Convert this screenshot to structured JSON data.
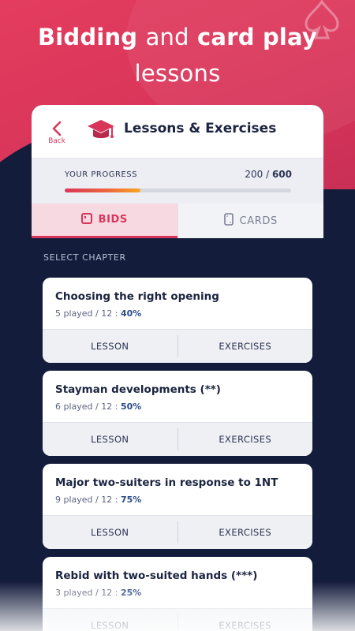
{
  "headline": {
    "line1_bold": "Bidding",
    "line1_light": "and",
    "line1_bold2": "card play",
    "line2": "lessons"
  },
  "header": {
    "back_label": "Back",
    "title": "Lessons & Exercises"
  },
  "progress": {
    "label": "YOUR PROGRESS",
    "current": "200",
    "separator": " / ",
    "total": "600",
    "fraction": 0.333
  },
  "tabs": [
    {
      "label": "BIDS",
      "active": true,
      "icon": "bids-icon"
    },
    {
      "label": "CARDS",
      "active": false,
      "icon": "card-icon"
    }
  ],
  "section_label": "SELECT CHAPTER",
  "chapters": [
    {
      "title": "Choosing the right opening",
      "stats": "5 played / 12 : ",
      "pct": "40%",
      "lesson": "LESSON",
      "exercises": "EXERCISES"
    },
    {
      "title": "Stayman developments (**)",
      "stats": "6 played / 12 : ",
      "pct": "50%",
      "lesson": "LESSON",
      "exercises": "EXERCISES"
    },
    {
      "title": "Major two-suiters in response to 1NT",
      "stats": "9 played / 12 : ",
      "pct": "75%",
      "lesson": "LESSON",
      "exercises": "EXERCISES"
    },
    {
      "title": "Rebid with two-suited hands (***)",
      "stats": "3 played / 12 : ",
      "pct": "25%",
      "lesson": "LESSON",
      "exercises": "EXERCISES"
    }
  ],
  "colors": {
    "accent": "#d8355a",
    "navy": "#141c3c",
    "percent": "#2a4a8a"
  }
}
